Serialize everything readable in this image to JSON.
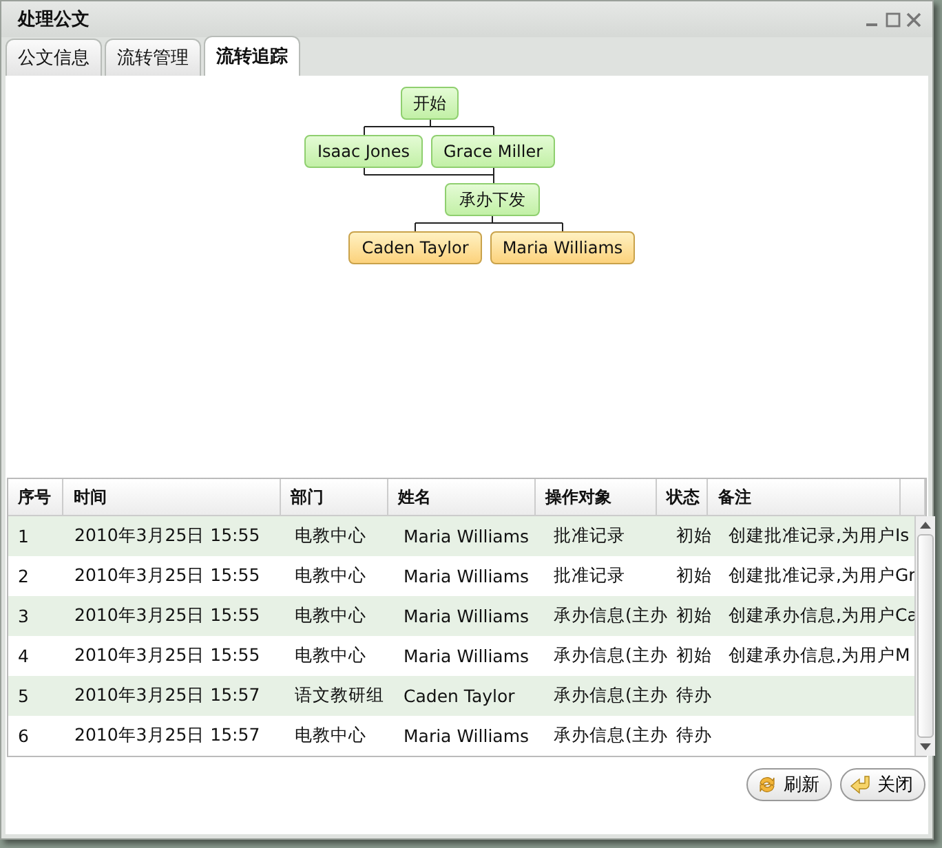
{
  "window": {
    "title": "处理公文"
  },
  "tabs": [
    {
      "label": "公文信息",
      "selected": false
    },
    {
      "label": "流转管理",
      "selected": false
    },
    {
      "label": "流转追踪",
      "selected": true
    }
  ],
  "flow": {
    "nodes": [
      {
        "label": "开始",
        "kind": "done"
      },
      {
        "label": "Isaac Jones",
        "kind": "done"
      },
      {
        "label": "Grace Miller",
        "kind": "done"
      },
      {
        "label": "承办下发",
        "kind": "done"
      },
      {
        "label": "Caden Taylor",
        "kind": "pending"
      },
      {
        "label": "Maria Williams",
        "kind": "pending"
      }
    ]
  },
  "table": {
    "columns": [
      "序号",
      "时间",
      "部门",
      "姓名",
      "操作对象",
      "状态",
      "备注"
    ],
    "rows": [
      [
        "1",
        "2010年3月25日 15:55",
        "电教中心",
        "Maria Williams",
        "批准记录",
        "初始",
        "创建批准记录,为用户Is"
      ],
      [
        "2",
        "2010年3月25日 15:55",
        "电教中心",
        "Maria Williams",
        "批准记录",
        "初始",
        "创建批准记录,为用户Gr"
      ],
      [
        "3",
        "2010年3月25日 15:55",
        "电教中心",
        "Maria Williams",
        "承办信息(主办",
        "初始",
        "创建承办信息,为用户Ca"
      ],
      [
        "4",
        "2010年3月25日 15:55",
        "电教中心",
        "Maria Williams",
        "承办信息(主办",
        "初始",
        "创建承办信息,为用户M"
      ],
      [
        "5",
        "2010年3月25日 15:57",
        "语文教研组",
        "Caden Taylor",
        "承办信息(主办",
        "待办",
        ""
      ],
      [
        "6",
        "2010年3月25日 15:57",
        "电教中心",
        "Maria Williams",
        "承办信息(主办",
        "待办",
        ""
      ]
    ]
  },
  "buttons": [
    {
      "label": "刷新",
      "kind": "refresh"
    },
    {
      "label": "关闭",
      "kind": "close"
    }
  ]
}
